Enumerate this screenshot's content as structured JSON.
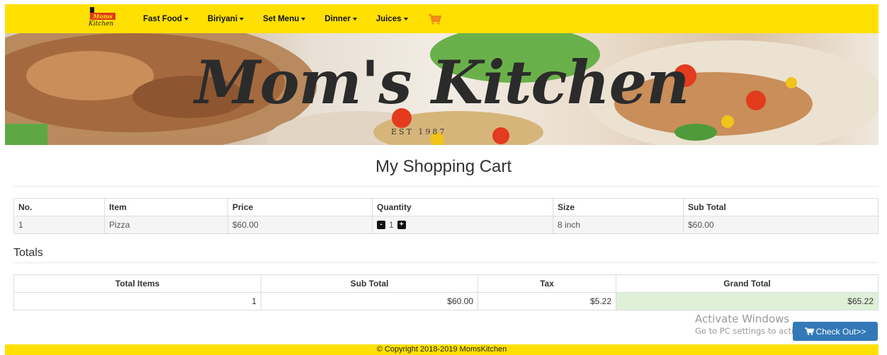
{
  "navbar": {
    "logo": {
      "top_text": "Moms",
      "bottom_text": "Kitchen"
    },
    "menu": [
      {
        "label": "Fast Food"
      },
      {
        "label": "Biriyani"
      },
      {
        "label": "Set Menu"
      },
      {
        "label": "Dinner"
      },
      {
        "label": "Juices"
      }
    ],
    "cart_icon": "shopping-cart-icon",
    "accent_color": "#ffe000"
  },
  "banner": {
    "title": "Mom's Kitchen",
    "subtitle": "EST 1987"
  },
  "cart": {
    "title": "My Shopping Cart",
    "columns": [
      "No.",
      "Item",
      "Price",
      "Quantity",
      "Size",
      "Sub Total"
    ],
    "rows": [
      {
        "no": "1",
        "item": "Pizza",
        "price": "$60.00",
        "quantity": "1",
        "size": "8 inch",
        "subtotal": "$60.00"
      }
    ],
    "minus_label": "-",
    "plus_label": "+"
  },
  "totals": {
    "heading": "Totals",
    "columns": [
      "Total Items",
      "Sub Total",
      "Tax",
      "Grand Total"
    ],
    "values": {
      "total_items": "1",
      "sub_total": "$60.00",
      "tax": "$5.22",
      "grand_total": "$65.22"
    }
  },
  "watermark": {
    "line1": "Activate Windows",
    "line2": "Go to PC settings to activate Windows."
  },
  "checkout_label": "Check Out>>",
  "footer": "© Copyright 2018-2019 MomsKitchen"
}
